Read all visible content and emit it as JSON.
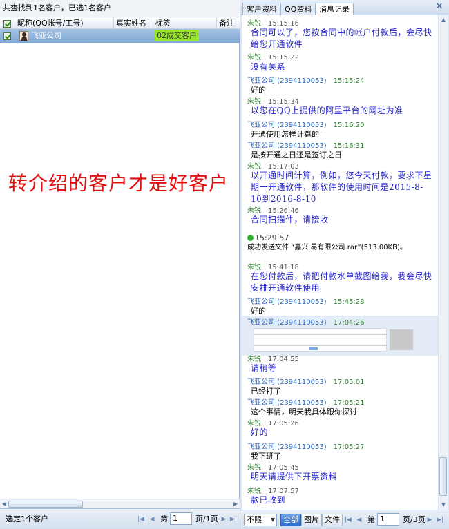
{
  "left": {
    "summary": "共查找到1名客户，已选1名客户",
    "columns": [
      "昵称(QQ帐号/工号)",
      "真实姓名",
      "标签",
      "备注"
    ],
    "rows": [
      {
        "name": "飞亚公司",
        "real_name": "",
        "tag": "02成交客户",
        "note": ""
      }
    ],
    "slogan": "转介绍的客户才是好客户",
    "footer": {
      "status": "选定1个客户",
      "page_prefix": "第",
      "page_value": "1",
      "page_suffix": "页/1页"
    }
  },
  "right": {
    "tabs": [
      "客户资料",
      "QQ资料",
      "消息记录"
    ],
    "active_tab": "消息记录",
    "messages": [
      {
        "sender": "朱锐",
        "time": "15:15:16",
        "text": "合同可以了，您按合同中的帐户付款后，会尽快给您开通软件"
      },
      {
        "sender": "朱锐",
        "time": "15:15:22",
        "text": "没有关系"
      },
      {
        "sender": "飞亚公司 (2394110053)",
        "time": "15:15:24",
        "text": "好的"
      },
      {
        "sender": "朱锐",
        "time": "15:15:34",
        "text": "以您在QQ上提供的阿里平台的网址为准"
      },
      {
        "sender": "飞亚公司 (2394110053)",
        "time": "15:16:20",
        "text": "开通使用怎样计算的"
      },
      {
        "sender": "飞亚公司 (2394110053)",
        "time": "15:16:31",
        "text": "是按开通之日还是签订之日"
      },
      {
        "sender": "朱锐",
        "time": "15:17:03",
        "text": "以开通时间计算，例如，您今天付款，要求下星期一开通软件，那软件的使用时间是2015-8-10到2016-8-10"
      },
      {
        "sender": "朱锐",
        "time": "15:26:46",
        "text": "合同扫描件，请接收"
      },
      {
        "sender": "",
        "time": "15:29:57",
        "text": "成功发送文件 “嘉兴     易有限公司.rar”(513.00KB)。"
      },
      {
        "sender": "朱锐",
        "time": "15:41:18",
        "text": "在您付款后，请把付款水单截图给我，我会尽快安排开通软件使用"
      },
      {
        "sender": "飞亚公司 (2394110053)",
        "time": "15:45:28",
        "text": "好的"
      },
      {
        "sender": "飞亚公司 (2394110053)",
        "time": "17:04:26",
        "text": ""
      },
      {
        "sender": "朱锐",
        "time": "17:04:55",
        "text": "请稍等"
      },
      {
        "sender": "飞亚公司 (2394110053)",
        "time": "17:05:01",
        "text": "已经打了"
      },
      {
        "sender": "飞亚公司 (2394110053)",
        "time": "17:05:21",
        "text": "这个事情，明天我具体跟你探讨"
      },
      {
        "sender": "朱锐",
        "time": "17:05:26",
        "text": "好的"
      },
      {
        "sender": "飞亚公司 (2394110053)",
        "time": "17:05:27",
        "text": "我下班了"
      },
      {
        "sender": "朱锐",
        "time": "17:05:45",
        "text": "明天请提供下开票资料"
      },
      {
        "sender": "朱锐",
        "time": "17:07:57",
        "text": "款已收到"
      }
    ],
    "footer": {
      "filter": "不限",
      "buttons": [
        "全部",
        "图片",
        "文件"
      ],
      "page_prefix": "第",
      "page_value": "1",
      "page_suffix": "页/3页"
    }
  },
  "colors": {
    "staff_text": "#2222cc",
    "staff_name": "#2f7d2f",
    "customer_name": "#2a62b8",
    "tag_bg": "#99e62e",
    "slogan": "#e01010",
    "selected_row": "#7ea7d3"
  },
  "icons": [
    "checkbox-icon",
    "avatar-icon",
    "close-icon",
    "success-icon",
    "first-page-icon",
    "prev-page-icon",
    "next-page-icon",
    "last-page-icon",
    "dropdown-icon"
  ]
}
